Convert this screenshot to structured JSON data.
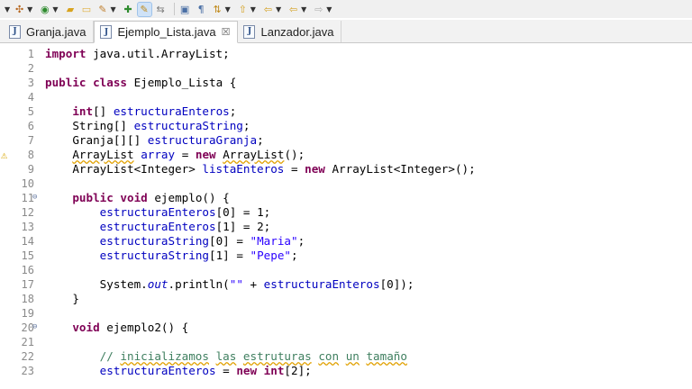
{
  "toolbar": {
    "icons": [
      "tools-icon",
      "run-icon",
      "open-folder-icon",
      "folder-icon",
      "edit-icon",
      "extension-icon",
      "highlight-icon",
      "toggle-icon",
      "page-icon",
      "paragraph-icon",
      "sort-icon",
      "up-arrow-icon",
      "back-icon",
      "forward-icon",
      "next-icon"
    ]
  },
  "tabs": [
    {
      "label": "Granja.java",
      "active": false
    },
    {
      "label": "Ejemplo_Lista.java",
      "active": true,
      "close": "☒"
    },
    {
      "label": "Lanzador.java",
      "active": false
    }
  ],
  "editor": {
    "lines": [
      {
        "n": "1",
        "text": "import java.util.ArrayList;"
      },
      {
        "n": "2",
        "text": ""
      },
      {
        "n": "3",
        "text": "public class Ejemplo_Lista {"
      },
      {
        "n": "4",
        "text": ""
      },
      {
        "n": "5",
        "text": "    int[] estructuraEnteros;"
      },
      {
        "n": "6",
        "text": "    String[] estructuraString;"
      },
      {
        "n": "7",
        "text": "    Granja[][] estructuraGranja;"
      },
      {
        "n": "8",
        "text": "    ArrayList array = new ArrayList();"
      },
      {
        "n": "9",
        "text": "    ArrayList<Integer> listaEnteros = new ArrayList<Integer>();"
      },
      {
        "n": "10",
        "text": ""
      },
      {
        "n": "11",
        "text": "    public void ejemplo() {"
      },
      {
        "n": "12",
        "text": "        estructuraEnteros[0] = 1;"
      },
      {
        "n": "13",
        "text": "        estructuraEnteros[1] = 2;"
      },
      {
        "n": "14",
        "text": "        estructuraString[0] = \"Maria\";"
      },
      {
        "n": "15",
        "text": "        estructuraString[1] = \"Pepe\";"
      },
      {
        "n": "16",
        "text": ""
      },
      {
        "n": "17",
        "text": "        System.out.println(\"\" + estructuraEnteros[0]);"
      },
      {
        "n": "18",
        "text": "    }"
      },
      {
        "n": "19",
        "text": ""
      },
      {
        "n": "20",
        "text": "    void ejemplo2() {"
      },
      {
        "n": "21",
        "text": ""
      },
      {
        "n": "22",
        "text": "        // inicializamos las estruturas con un tamaño"
      },
      {
        "n": "23",
        "text": "        estructuraEnteros = new int[2];"
      }
    ],
    "fold_marker": "⊖",
    "warning_marker": "⚠"
  }
}
